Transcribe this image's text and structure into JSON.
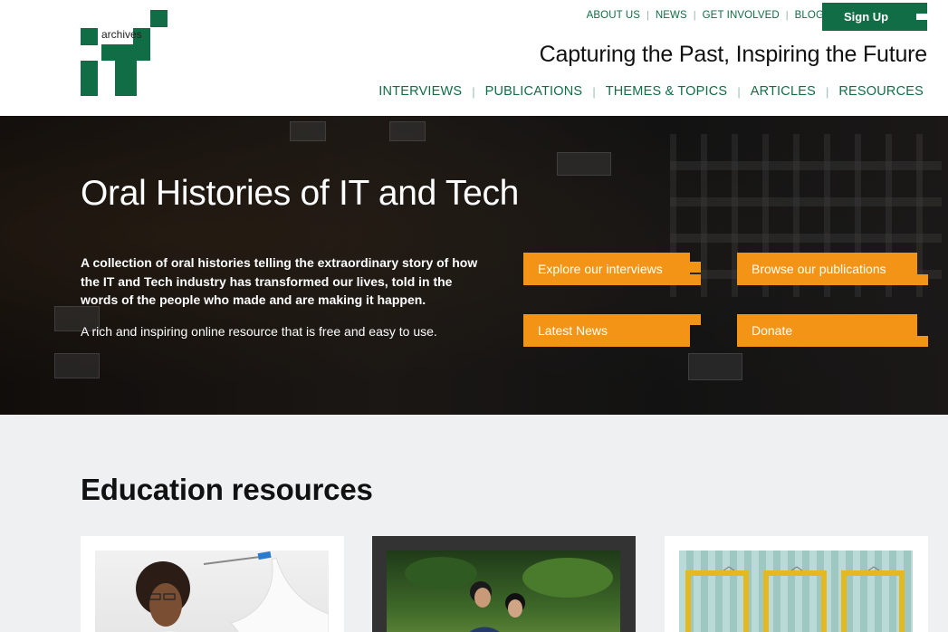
{
  "header": {
    "logo_text": "archives",
    "top_nav": [
      "ABOUT US",
      "NEWS",
      "GET INVOLVED",
      "BLOG"
    ],
    "signup_label": "Sign Up",
    "tagline": "Capturing the Past, Inspiring the Future",
    "main_nav": [
      "INTERVIEWS",
      "PUBLICATIONS",
      "THEMES & TOPICS",
      "ARTICLES",
      "RESOURCES"
    ]
  },
  "hero": {
    "title": "Oral Histories of IT and Tech",
    "lead": "A collection of oral histories telling the extraordinary story of how the IT and Tech industry has transformed our lives, told in the words of the people who made and are making it happen.",
    "sub": "A rich and inspiring online resource that is free and easy to use.",
    "buttons": [
      "Explore our interviews",
      "Browse our publications",
      "Latest News",
      "Donate"
    ]
  },
  "education": {
    "title": "Education resources"
  },
  "colors": {
    "brand_green": "#116d45",
    "accent_orange": "#f39416"
  }
}
